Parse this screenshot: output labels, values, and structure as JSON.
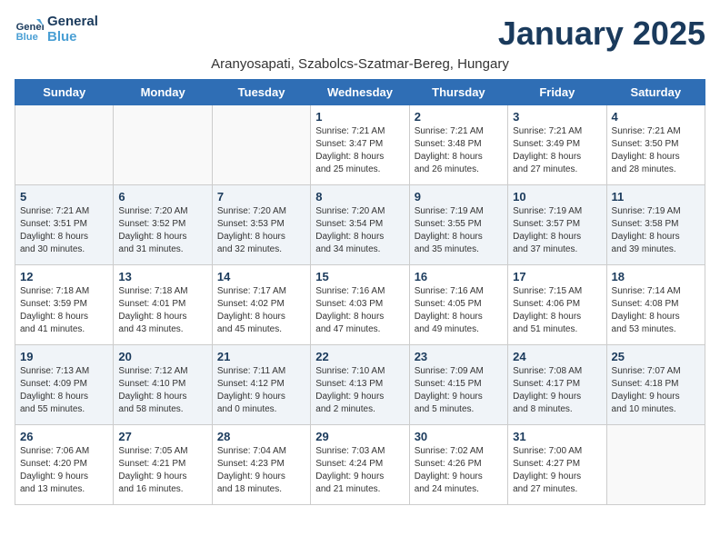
{
  "app": {
    "logo_line1": "General",
    "logo_line2": "Blue"
  },
  "header": {
    "title": "January 2025",
    "subtitle": "Aranyosapati, Szabolcs-Szatmar-Bereg, Hungary"
  },
  "weekdays": [
    "Sunday",
    "Monday",
    "Tuesday",
    "Wednesday",
    "Thursday",
    "Friday",
    "Saturday"
  ],
  "weeks": [
    [
      {
        "day": "",
        "details": ""
      },
      {
        "day": "",
        "details": ""
      },
      {
        "day": "",
        "details": ""
      },
      {
        "day": "1",
        "details": "Sunrise: 7:21 AM\nSunset: 3:47 PM\nDaylight: 8 hours\nand 25 minutes."
      },
      {
        "day": "2",
        "details": "Sunrise: 7:21 AM\nSunset: 3:48 PM\nDaylight: 8 hours\nand 26 minutes."
      },
      {
        "day": "3",
        "details": "Sunrise: 7:21 AM\nSunset: 3:49 PM\nDaylight: 8 hours\nand 27 minutes."
      },
      {
        "day": "4",
        "details": "Sunrise: 7:21 AM\nSunset: 3:50 PM\nDaylight: 8 hours\nand 28 minutes."
      }
    ],
    [
      {
        "day": "5",
        "details": "Sunrise: 7:21 AM\nSunset: 3:51 PM\nDaylight: 8 hours\nand 30 minutes."
      },
      {
        "day": "6",
        "details": "Sunrise: 7:20 AM\nSunset: 3:52 PM\nDaylight: 8 hours\nand 31 minutes."
      },
      {
        "day": "7",
        "details": "Sunrise: 7:20 AM\nSunset: 3:53 PM\nDaylight: 8 hours\nand 32 minutes."
      },
      {
        "day": "8",
        "details": "Sunrise: 7:20 AM\nSunset: 3:54 PM\nDaylight: 8 hours\nand 34 minutes."
      },
      {
        "day": "9",
        "details": "Sunrise: 7:19 AM\nSunset: 3:55 PM\nDaylight: 8 hours\nand 35 minutes."
      },
      {
        "day": "10",
        "details": "Sunrise: 7:19 AM\nSunset: 3:57 PM\nDaylight: 8 hours\nand 37 minutes."
      },
      {
        "day": "11",
        "details": "Sunrise: 7:19 AM\nSunset: 3:58 PM\nDaylight: 8 hours\nand 39 minutes."
      }
    ],
    [
      {
        "day": "12",
        "details": "Sunrise: 7:18 AM\nSunset: 3:59 PM\nDaylight: 8 hours\nand 41 minutes."
      },
      {
        "day": "13",
        "details": "Sunrise: 7:18 AM\nSunset: 4:01 PM\nDaylight: 8 hours\nand 43 minutes."
      },
      {
        "day": "14",
        "details": "Sunrise: 7:17 AM\nSunset: 4:02 PM\nDaylight: 8 hours\nand 45 minutes."
      },
      {
        "day": "15",
        "details": "Sunrise: 7:16 AM\nSunset: 4:03 PM\nDaylight: 8 hours\nand 47 minutes."
      },
      {
        "day": "16",
        "details": "Sunrise: 7:16 AM\nSunset: 4:05 PM\nDaylight: 8 hours\nand 49 minutes."
      },
      {
        "day": "17",
        "details": "Sunrise: 7:15 AM\nSunset: 4:06 PM\nDaylight: 8 hours\nand 51 minutes."
      },
      {
        "day": "18",
        "details": "Sunrise: 7:14 AM\nSunset: 4:08 PM\nDaylight: 8 hours\nand 53 minutes."
      }
    ],
    [
      {
        "day": "19",
        "details": "Sunrise: 7:13 AM\nSunset: 4:09 PM\nDaylight: 8 hours\nand 55 minutes."
      },
      {
        "day": "20",
        "details": "Sunrise: 7:12 AM\nSunset: 4:10 PM\nDaylight: 8 hours\nand 58 minutes."
      },
      {
        "day": "21",
        "details": "Sunrise: 7:11 AM\nSunset: 4:12 PM\nDaylight: 9 hours\nand 0 minutes."
      },
      {
        "day": "22",
        "details": "Sunrise: 7:10 AM\nSunset: 4:13 PM\nDaylight: 9 hours\nand 2 minutes."
      },
      {
        "day": "23",
        "details": "Sunrise: 7:09 AM\nSunset: 4:15 PM\nDaylight: 9 hours\nand 5 minutes."
      },
      {
        "day": "24",
        "details": "Sunrise: 7:08 AM\nSunset: 4:17 PM\nDaylight: 9 hours\nand 8 minutes."
      },
      {
        "day": "25",
        "details": "Sunrise: 7:07 AM\nSunset: 4:18 PM\nDaylight: 9 hours\nand 10 minutes."
      }
    ],
    [
      {
        "day": "26",
        "details": "Sunrise: 7:06 AM\nSunset: 4:20 PM\nDaylight: 9 hours\nand 13 minutes."
      },
      {
        "day": "27",
        "details": "Sunrise: 7:05 AM\nSunset: 4:21 PM\nDaylight: 9 hours\nand 16 minutes."
      },
      {
        "day": "28",
        "details": "Sunrise: 7:04 AM\nSunset: 4:23 PM\nDaylight: 9 hours\nand 18 minutes."
      },
      {
        "day": "29",
        "details": "Sunrise: 7:03 AM\nSunset: 4:24 PM\nDaylight: 9 hours\nand 21 minutes."
      },
      {
        "day": "30",
        "details": "Sunrise: 7:02 AM\nSunset: 4:26 PM\nDaylight: 9 hours\nand 24 minutes."
      },
      {
        "day": "31",
        "details": "Sunrise: 7:00 AM\nSunset: 4:27 PM\nDaylight: 9 hours\nand 27 minutes."
      },
      {
        "day": "",
        "details": ""
      }
    ]
  ]
}
